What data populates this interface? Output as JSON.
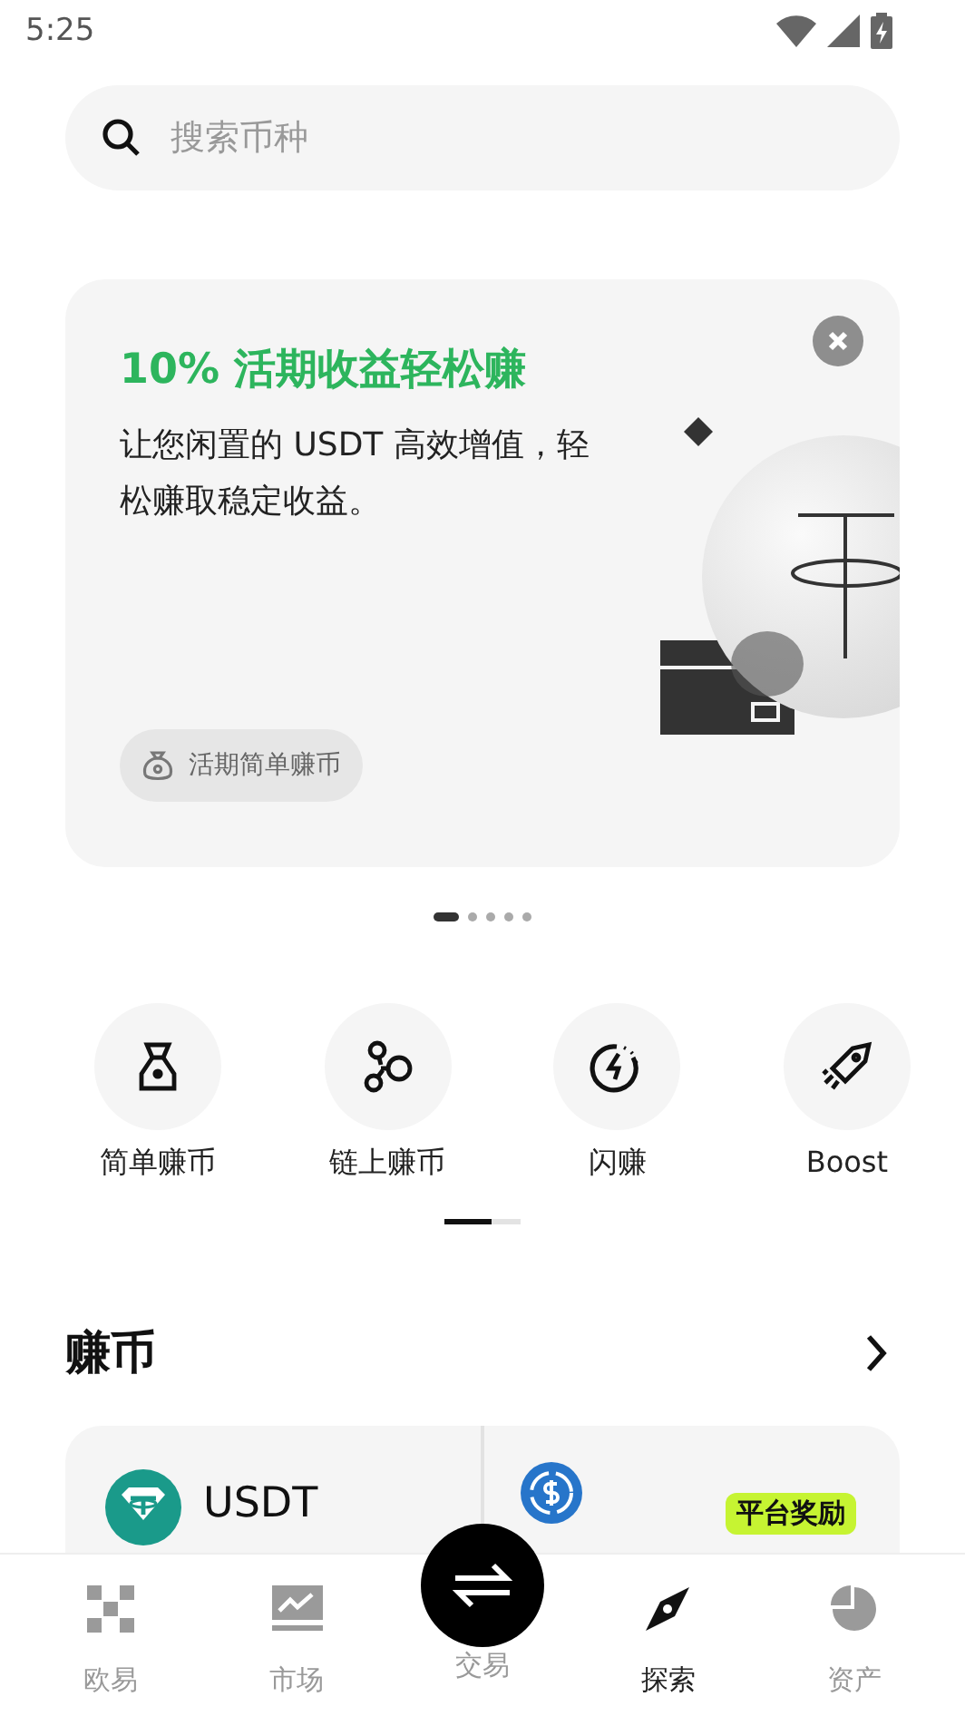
{
  "status_bar": {
    "time": "5:25"
  },
  "search": {
    "placeholder": "搜索币种"
  },
  "banner": {
    "title": "10% 活期收益轻松赚",
    "body": "让您闲置的 USDT 高效增值，轻松赚取稳定收益。",
    "tag": "活期简单赚币"
  },
  "banner_pager": [
    {
      "selected": true
    },
    {
      "selected": false
    },
    {
      "selected": false
    },
    {
      "selected": false
    },
    {
      "selected": false
    }
  ],
  "shortcuts": [
    {
      "label": "简单赚币",
      "kind": "bag"
    },
    {
      "label": "链上赚币",
      "kind": "chain"
    },
    {
      "label": "闪赚",
      "kind": "flash"
    },
    {
      "label": "Boost",
      "kind": "rocket"
    }
  ],
  "section": {
    "title": "赚币"
  },
  "coins": [
    {
      "name": "USDT",
      "kind": "usdt"
    },
    {
      "kind": "usdc",
      "badge": "平台奖励"
    }
  ],
  "nav": [
    {
      "label": "欧易",
      "kind": "home",
      "selected": false
    },
    {
      "label": "市场",
      "kind": "market",
      "selected": false
    },
    {
      "label": "交易",
      "kind": "trade",
      "selected": false
    },
    {
      "label": "探索",
      "kind": "explore",
      "selected": true
    },
    {
      "label": "资产",
      "kind": "assets",
      "selected": false
    }
  ]
}
